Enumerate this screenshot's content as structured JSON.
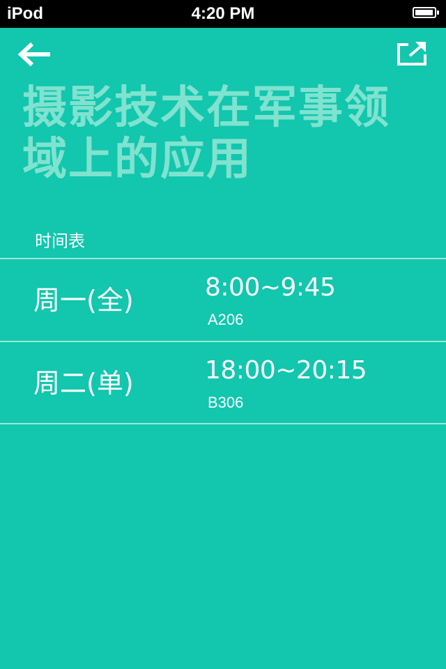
{
  "status_bar": {
    "carrier": "iPod",
    "time": "4:20 PM",
    "battery_level": 0.95
  },
  "nav": {
    "back_icon": "arrow-left-icon",
    "share_icon": "share-icon"
  },
  "course": {
    "title": "摄影技术在军事领域上的应用"
  },
  "schedule": {
    "header": "时间表",
    "items": [
      {
        "day": "周一(全)",
        "time": "8:00~9:45",
        "room": "A206"
      },
      {
        "day": "周二(单)",
        "time": "18:00~20:15",
        "room": "B306"
      }
    ]
  },
  "colors": {
    "background": "#13c6ae",
    "title": "#7fe3cf",
    "divider": "#9be8da"
  }
}
